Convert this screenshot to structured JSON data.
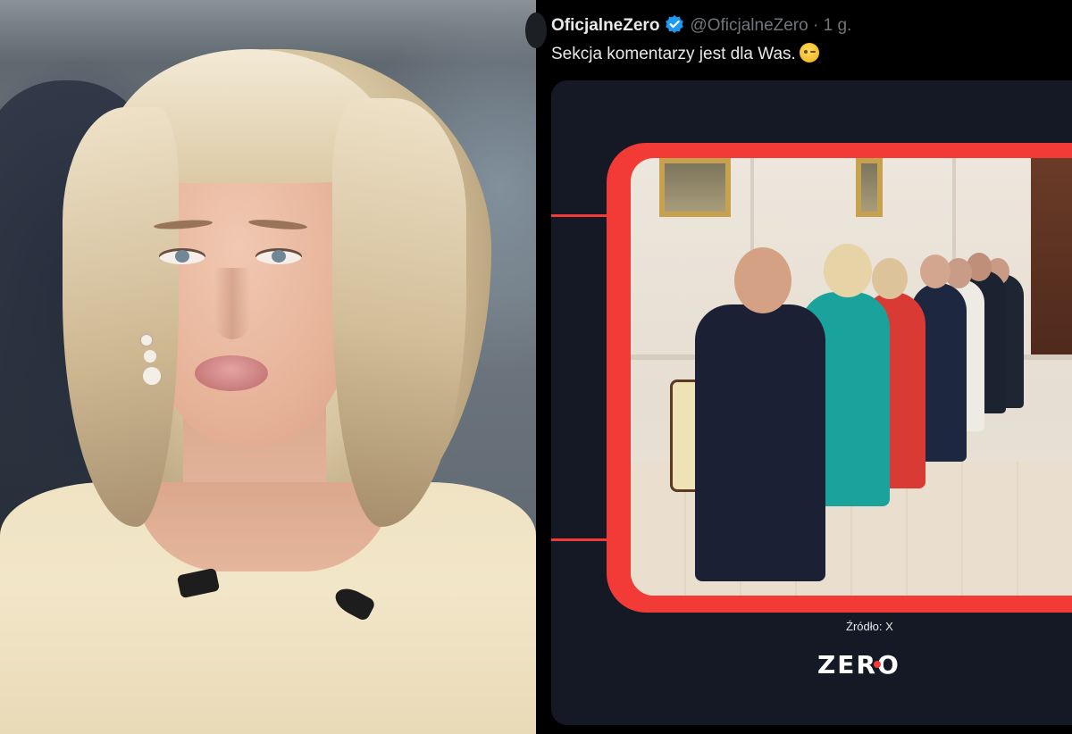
{
  "tweet": {
    "author_name": "OficjalneZero",
    "handle": "@OficjalneZero",
    "separator": "·",
    "time": "1 g.",
    "text": "Sekcja komentarzy jest dla Was.",
    "emoji": "winking-face-emoji"
  },
  "media": {
    "source_label": "Źródło: X",
    "logo_text": "ZERO"
  },
  "colors": {
    "background": "#000000",
    "card_background": "#141925",
    "accent_red": "#f23b36",
    "verified_blue": "#1d9bf0",
    "secondary_text": "#71767b"
  }
}
